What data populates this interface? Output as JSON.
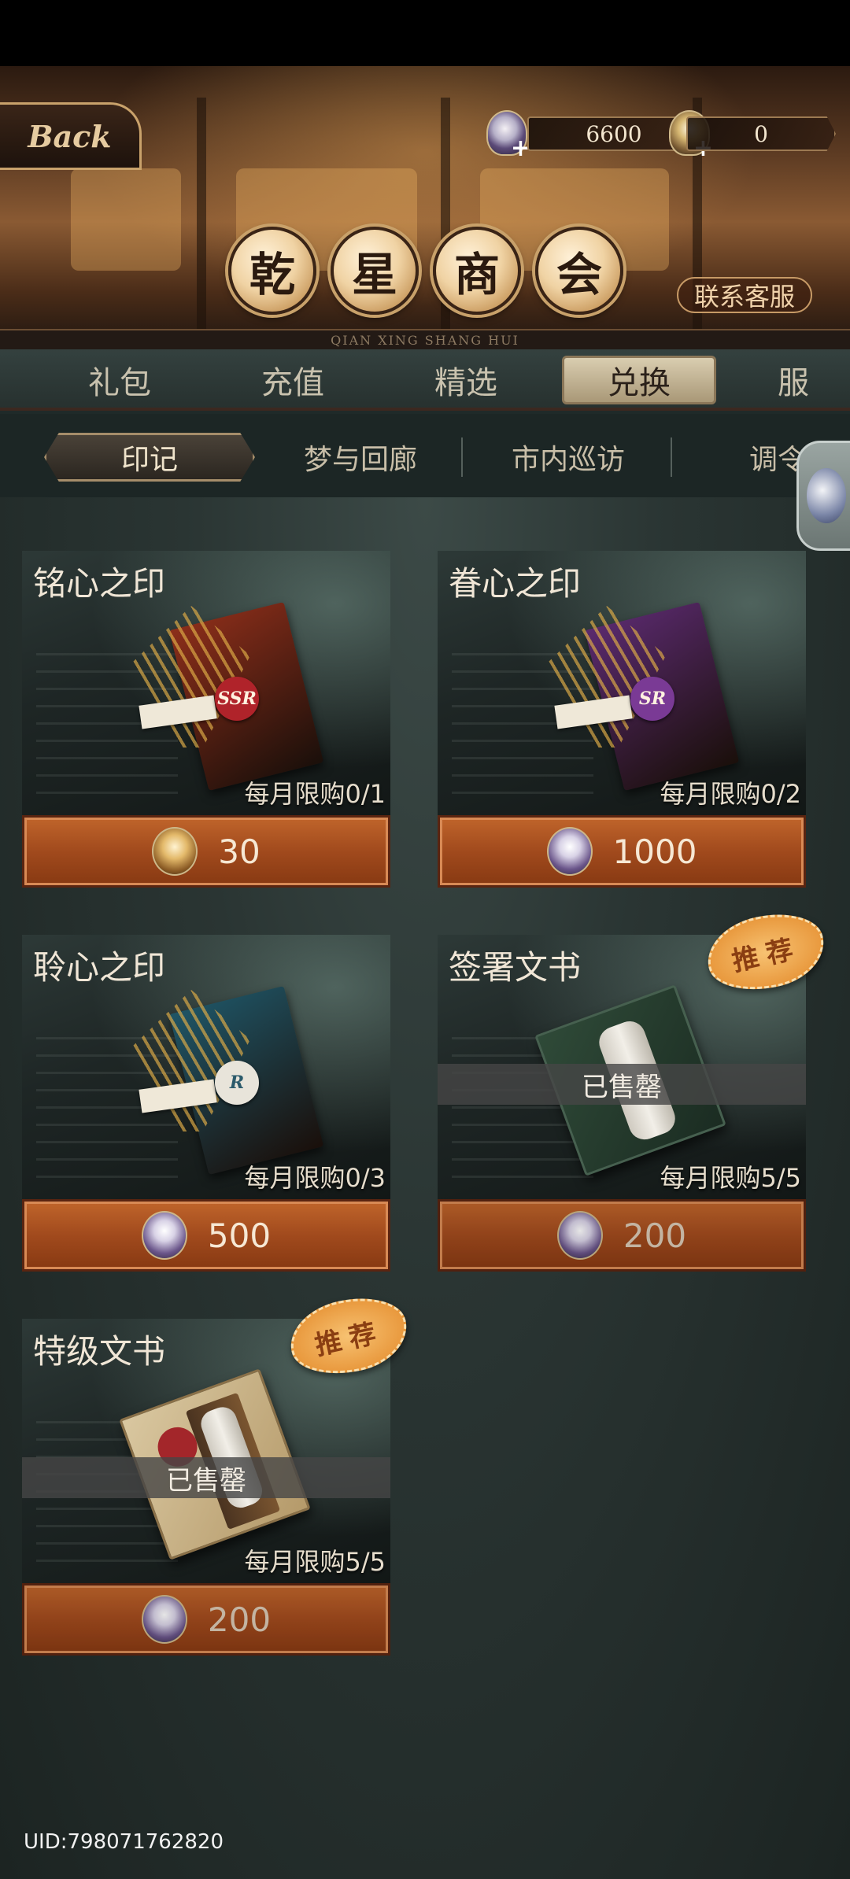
{
  "header": {
    "back_label": "Back",
    "currencies": [
      {
        "icon": "crystal-globe-icon",
        "value": "6600"
      },
      {
        "icon": "golden-lamp-icon",
        "value": "0"
      }
    ],
    "title_chars": [
      "乾",
      "星",
      "商",
      "会"
    ],
    "subtitle": "QIAN XING SHANG HUI",
    "support_label": "联系客服"
  },
  "main_tabs": [
    {
      "label": "礼包",
      "active": false
    },
    {
      "label": "充值",
      "active": false
    },
    {
      "label": "精选",
      "active": false
    },
    {
      "label": "兑换",
      "active": true
    },
    {
      "label": "服",
      "active": false
    }
  ],
  "sub_tabs": [
    {
      "label": "印记",
      "active": true
    },
    {
      "label": "梦与回廊",
      "active": false
    },
    {
      "label": "市内巡访",
      "active": false
    },
    {
      "label": "调令",
      "active": false
    }
  ],
  "items": [
    {
      "title": "铭心之印",
      "limit": "每月限购0/1",
      "price": "30",
      "currency_icon": "golden-lamp-icon",
      "seal_text": "SSR",
      "letter_color": "#8c2e1a",
      "sold_out": false,
      "badge": ""
    },
    {
      "title": "眷心之印",
      "limit": "每月限购0/2",
      "price": "1000",
      "currency_icon": "crystal-globe-icon",
      "seal_text": "SR",
      "letter_color": "#5a2a6e",
      "sold_out": false,
      "badge": ""
    },
    {
      "title": "聆心之印",
      "limit": "每月限购0/3",
      "price": "500",
      "currency_icon": "crystal-globe-icon",
      "seal_text": "R",
      "letter_color": "#1f5566",
      "sold_out": false,
      "badge": ""
    },
    {
      "title": "签署文书",
      "limit": "每月限购5/5",
      "price": "200",
      "currency_icon": "crystal-globe-icon",
      "sold_out": true,
      "sold_out_label": "已售罄",
      "badge": "推荐"
    },
    {
      "title": "特级文书",
      "limit": "每月限购5/5",
      "price": "200",
      "currency_icon": "crystal-globe-icon",
      "sold_out": true,
      "sold_out_label": "已售罄",
      "badge": "推荐"
    }
  ],
  "footer": {
    "uid": "UID:798071762820"
  }
}
